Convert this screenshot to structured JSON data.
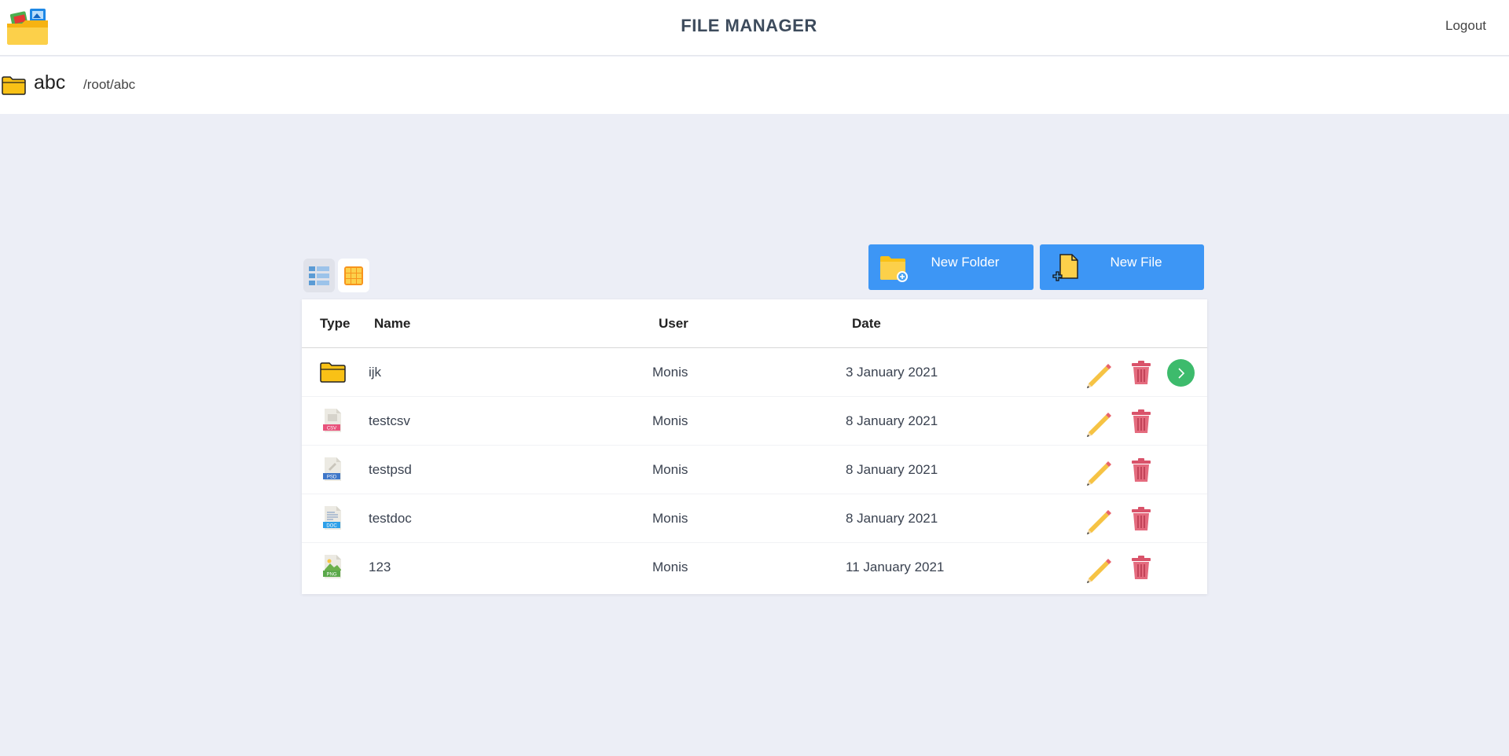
{
  "header": {
    "title": "FILE MANAGER",
    "logout_label": "Logout"
  },
  "location": {
    "folder_name": "abc",
    "path": "/root/abc"
  },
  "toolbar": {
    "new_folder_label": "New Folder",
    "new_file_label": "New File",
    "active_view": "list"
  },
  "table": {
    "columns": [
      "Type",
      "Name",
      "User",
      "Date"
    ],
    "rows": [
      {
        "type": "folder",
        "name": "ijk",
        "user": "Monis",
        "date": "3 January 2021"
      },
      {
        "type": "CSV",
        "name": "testcsv",
        "user": "Monis",
        "date": "8 January 2021"
      },
      {
        "type": "PSD",
        "name": "testpsd",
        "user": "Monis",
        "date": "8 January 2021"
      },
      {
        "type": "DOC",
        "name": "testdoc",
        "user": "Monis",
        "date": "8 January 2021"
      },
      {
        "type": "PNG",
        "name": "123",
        "user": "Monis",
        "date": "11 January 2021"
      }
    ]
  },
  "icons": {
    "folder_color": "#f9c116",
    "edit": "pencil-icon",
    "delete": "trash-icon",
    "open": "chevron-right-icon",
    "csv_color": "#e8537c",
    "psd_color": "#3f77c8",
    "doc_color": "#2ea0e8",
    "png_color": "#5aa84a",
    "open_button_color": "#3dbb6c",
    "primary_button_color": "#3d96f5"
  }
}
